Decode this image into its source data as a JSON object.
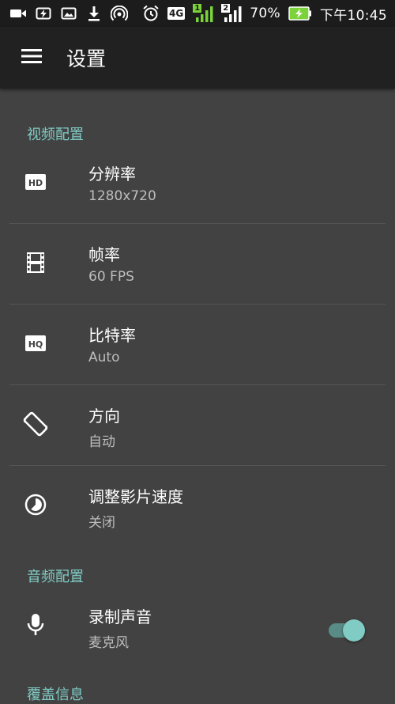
{
  "status_bar": {
    "battery_percent": "70%",
    "time": "下午10:45",
    "network_type": "4G",
    "sim1_label": "1",
    "sim2_label": "2",
    "icons": [
      "video-camera-icon",
      "battery-saver-icon",
      "image-icon",
      "download-icon",
      "hotspot-icon",
      "alarm-icon",
      "network-4g-icon",
      "signal-sim1-icon",
      "signal-sim2-icon",
      "battery-charging-icon"
    ]
  },
  "app_bar": {
    "title": "设置",
    "menu_icon": "menu-icon"
  },
  "sections": {
    "video": {
      "header": "视频配置",
      "items": [
        {
          "title": "分辨率",
          "summary": "1280x720",
          "icon": "hd-icon"
        },
        {
          "title": "帧率",
          "summary": "60 FPS",
          "icon": "film-icon"
        },
        {
          "title": "比特率",
          "summary": "Auto",
          "icon": "hq-icon"
        },
        {
          "title": "方向",
          "summary": "自动",
          "icon": "screen-rotation-icon"
        },
        {
          "title": "调整影片速度",
          "summary": "关闭",
          "icon": "timelapse-icon"
        }
      ]
    },
    "audio": {
      "header": "音频配置",
      "items": [
        {
          "title": "录制声音",
          "summary": "麦克风",
          "icon": "microphone-icon",
          "toggle_on": true
        }
      ]
    },
    "overlay": {
      "header": "覆盖信息"
    }
  },
  "colors": {
    "accent": "#80cbc4",
    "background": "#424242",
    "app_bar": "#212121",
    "status_bar": "#1c1c1c"
  }
}
